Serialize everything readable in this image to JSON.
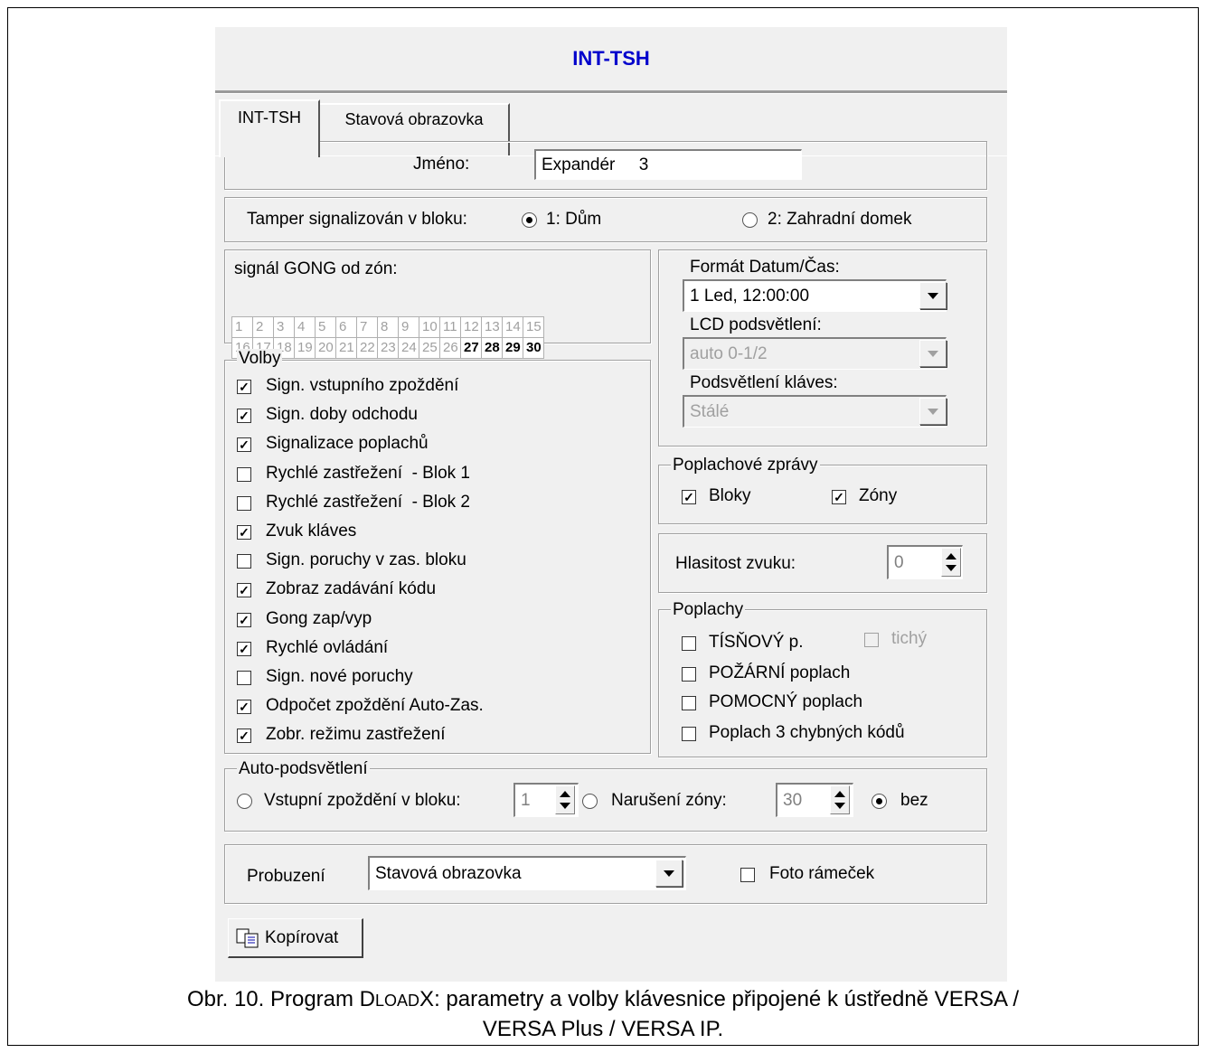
{
  "window_title": "INT-TSH",
  "tabs": [
    {
      "label": "INT-TSH",
      "active": true
    },
    {
      "label": "Stavová obrazovka",
      "active": false
    }
  ],
  "name": {
    "label": "Jméno:",
    "value": "Expandér     3"
  },
  "tamper": {
    "label": "Tamper signalizován v bloku:",
    "options": [
      {
        "label": "1: Dům",
        "selected": true
      },
      {
        "label": "2: Zahradní domek",
        "selected": false
      }
    ]
  },
  "gong": {
    "label": "signál GONG od zón:",
    "zones": [
      {
        "n": "1",
        "on": false
      },
      {
        "n": "2",
        "on": false
      },
      {
        "n": "3",
        "on": false
      },
      {
        "n": "4",
        "on": false
      },
      {
        "n": "5",
        "on": false
      },
      {
        "n": "6",
        "on": false
      },
      {
        "n": "7",
        "on": false
      },
      {
        "n": "8",
        "on": false
      },
      {
        "n": "9",
        "on": false
      },
      {
        "n": "10",
        "on": false
      },
      {
        "n": "11",
        "on": false
      },
      {
        "n": "12",
        "on": false
      },
      {
        "n": "13",
        "on": false
      },
      {
        "n": "14",
        "on": false
      },
      {
        "n": "15",
        "on": false
      },
      {
        "n": "16",
        "on": false
      },
      {
        "n": "17",
        "on": false
      },
      {
        "n": "18",
        "on": false
      },
      {
        "n": "19",
        "on": false
      },
      {
        "n": "20",
        "on": false
      },
      {
        "n": "21",
        "on": false
      },
      {
        "n": "22",
        "on": false
      },
      {
        "n": "23",
        "on": false
      },
      {
        "n": "24",
        "on": false
      },
      {
        "n": "25",
        "on": false
      },
      {
        "n": "26",
        "on": false
      },
      {
        "n": "27",
        "on": true
      },
      {
        "n": "28",
        "on": true
      },
      {
        "n": "29",
        "on": true
      },
      {
        "n": "30",
        "on": true
      }
    ]
  },
  "volby": {
    "legend": "Volby",
    "items": [
      {
        "label": "Sign. vstupního zpoždění",
        "checked": true
      },
      {
        "label": "Sign. doby odchodu",
        "checked": true
      },
      {
        "label": "Signalizace poplachů",
        "checked": true
      },
      {
        "label": "Rychlé zastřežení  - Blok 1",
        "checked": false
      },
      {
        "label": "Rychlé zastřežení  - Blok 2",
        "checked": false
      },
      {
        "label": "Zvuk kláves",
        "checked": true
      },
      {
        "label": "Sign. poruchy v zas. bloku",
        "checked": false
      },
      {
        "label": "Zobraz zadávání kódu",
        "checked": true
      },
      {
        "label": "Gong zap/vyp",
        "checked": true
      },
      {
        "label": "Rychlé ovládání",
        "checked": true
      },
      {
        "label": "Sign. nové poruchy",
        "checked": false
      },
      {
        "label": "Odpočet zpoždění Auto-Zas.",
        "checked": true
      },
      {
        "label": "Zobr. režimu zastřežení",
        "checked": true
      }
    ]
  },
  "format": {
    "label": "Formát Datum/Čas:",
    "value": "1 Led, 12:00:00",
    "lcd_label": "LCD podsvětlení:",
    "lcd_value": "auto 0-1/2",
    "keys_label": "Podsvětlení kláves:",
    "keys_value": "Stálé"
  },
  "poplachove_zpravy": {
    "legend": "Poplachové zprávy",
    "bloky": {
      "label": "Bloky",
      "checked": true
    },
    "zony": {
      "label": "Zóny",
      "checked": true
    }
  },
  "volume": {
    "label": "Hlasitost zvuku:",
    "value": "0"
  },
  "poplachy": {
    "legend": "Poplachy",
    "tisnovy": {
      "label": "TÍSŇOVÝ p.",
      "checked": false
    },
    "tichy": {
      "label": "tichý",
      "checked": false
    },
    "pozarni": {
      "label": "POŽÁRNÍ poplach",
      "checked": false
    },
    "pomocny": {
      "label": "POMOCNÝ poplach",
      "checked": false
    },
    "chybne": {
      "label": "Poplach 3 chybných kódů",
      "checked": false
    }
  },
  "auto_podsvetleni": {
    "legend": "Auto-podsvětlení",
    "vstupni_label": "Vstupní zpoždění v bloku:",
    "vstupni_value": "1",
    "naruseni_label": "Narušení zóny:",
    "naruseni_value": "30",
    "bez_label": "bez",
    "selected": "bez"
  },
  "probuzeni": {
    "label": "Probuzení",
    "value": "Stavová obrazovka",
    "foto_label": "Foto rámeček",
    "foto_checked": false
  },
  "copy_button": {
    "label": "Kopírovat",
    "icon": "copy-icon"
  },
  "caption": {
    "prefix": "Obr. 10. Program D",
    "sc1": "LOAD",
    "x": "X",
    "rest1": ": parametry a volby klávesnice připojené k ústředně VERSA /",
    "line2": "VERSA Plus / VERSA IP."
  }
}
